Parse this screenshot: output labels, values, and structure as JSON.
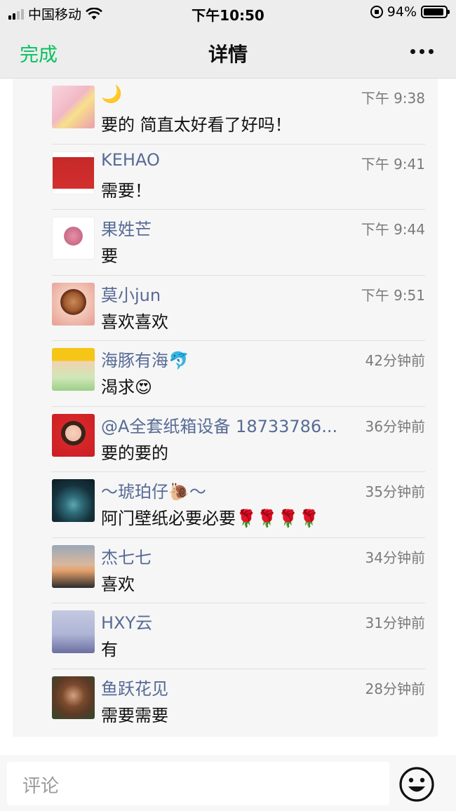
{
  "status_bar": {
    "carrier": "中国移动",
    "time": "下午10:50",
    "battery": "94%",
    "battery_level": 0.94
  },
  "nav": {
    "done_label": "完成",
    "title": "详情",
    "more_icon": "more-dots-icon",
    "accent_color": "#07c160"
  },
  "comments": [
    {
      "name": "🌙",
      "time": "下午 9:38",
      "text": "要的 简直太好看了好吗！"
    },
    {
      "name": "KEHAO",
      "time": "下午 9:41",
      "text": "需要！"
    },
    {
      "name": "果姓芒",
      "time": "下午 9:44",
      "text": "要"
    },
    {
      "name": "莫小jun",
      "time": "下午 9:51",
      "text": "喜欢喜欢"
    },
    {
      "name": "海豚有海🐬",
      "time": "42分钟前",
      "text": "渴求😍"
    },
    {
      "name": "@A全套纸箱设备 18733786...",
      "time": "36分钟前",
      "text": "要的要的"
    },
    {
      "name": "～琥珀仔🐌～",
      "time": "35分钟前",
      "text": "阿门壁纸必要必要🌹🌹🌹🌹"
    },
    {
      "name": "杰七七",
      "time": "34分钟前",
      "text": "喜欢"
    },
    {
      "name": "HXY云",
      "time": "31分钟前",
      "text": "有"
    },
    {
      "name": "鱼跃花见",
      "time": "28分钟前",
      "text": "需要需要"
    }
  ],
  "input": {
    "placeholder": "评论",
    "emoji_icon": "smiley-face-icon"
  }
}
